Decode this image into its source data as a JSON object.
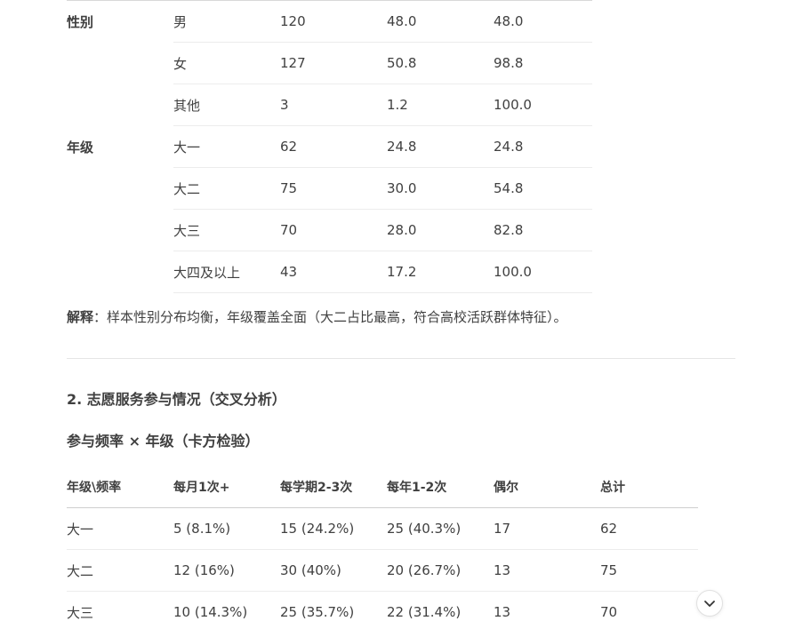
{
  "demographics_table": {
    "rows": [
      {
        "group": "性别",
        "item": "男",
        "count": "120",
        "percent": "48.0",
        "cumulative": "48.0"
      },
      {
        "group": "",
        "item": "女",
        "count": "127",
        "percent": "50.8",
        "cumulative": "98.8"
      },
      {
        "group": "",
        "item": "其他",
        "count": "3",
        "percent": "1.2",
        "cumulative": "100.0"
      },
      {
        "group": "年级",
        "item": "大一",
        "count": "62",
        "percent": "24.8",
        "cumulative": "24.8"
      },
      {
        "group": "",
        "item": "大二",
        "count": "75",
        "percent": "30.0",
        "cumulative": "54.8"
      },
      {
        "group": "",
        "item": "大三",
        "count": "70",
        "percent": "28.0",
        "cumulative": "82.8"
      },
      {
        "group": "",
        "item": "大四及以上",
        "count": "43",
        "percent": "17.2",
        "cumulative": "100.0"
      }
    ]
  },
  "explanation": {
    "label": "解释",
    "text": "：样本性别分布均衡，年级覆盖全面（大二占比最高，符合高校活跃群体特征）。"
  },
  "section2": {
    "heading": "2. 志愿服务参与情况（交叉分析）",
    "subheading": "参与频率 × 年级（卡方检验）"
  },
  "crosstab": {
    "headers": [
      "年级\\频率",
      "每月1次+",
      "每学期2-3次",
      "每年1-2次",
      "偶尔",
      "总计"
    ],
    "rows": [
      [
        "大一",
        "5 (8.1%)",
        "15 (24.2%)",
        "25 (40.3%)",
        "17",
        "62"
      ],
      [
        "大二",
        "12 (16%)",
        "30 (40%)",
        "20 (26.7%)",
        "13",
        "75"
      ],
      [
        "大三",
        "10 (14.3%)",
        "25 (35.7%)",
        "22 (31.4%)",
        "13",
        "70"
      ]
    ]
  },
  "icons": {
    "scroll_down": "chevron-down-icon"
  }
}
